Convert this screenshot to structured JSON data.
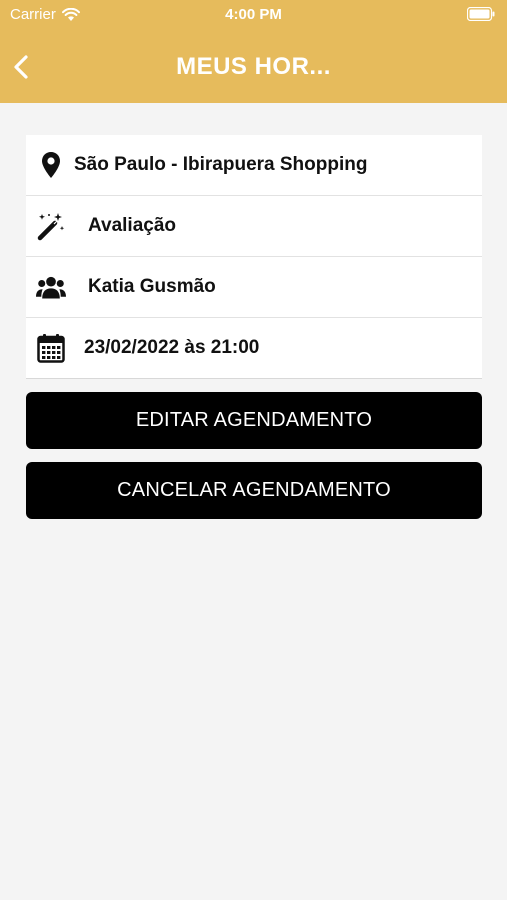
{
  "status_bar": {
    "carrier": "Carrier",
    "time": "4:00 PM"
  },
  "header": {
    "title": "MEUS HOR...",
    "background": "#e6bb5c"
  },
  "details": [
    {
      "icon": "location-pin-icon",
      "text": "São Paulo - Ibirapuera Shopping"
    },
    {
      "icon": "magic-wand-icon",
      "text": "Avaliação"
    },
    {
      "icon": "users-icon",
      "text": "Katia Gusmão"
    },
    {
      "icon": "calendar-icon",
      "text": "23/02/2022 às 21:00"
    }
  ],
  "actions": {
    "edit_label": "EDITAR AGENDAMENTO",
    "cancel_label": "CANCELAR AGENDAMENTO"
  }
}
